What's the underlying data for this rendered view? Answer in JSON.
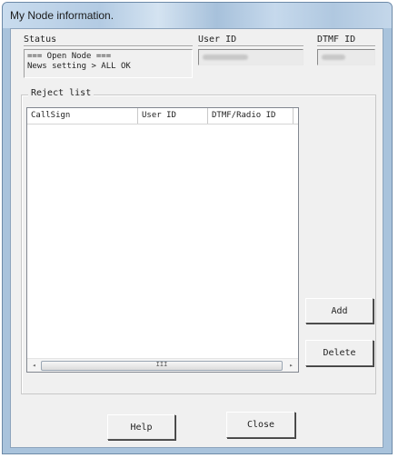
{
  "window": {
    "title": "My Node information."
  },
  "status": {
    "label": "Status",
    "line1": "=== Open Node ===",
    "line2": "News setting > ALL OK"
  },
  "user_id": {
    "label": "User ID"
  },
  "dtmf_id": {
    "label": "DTMF ID"
  },
  "reject_list": {
    "label": "Reject list",
    "columns": [
      "CallSign",
      "User ID",
      "DTMF/Radio ID"
    ],
    "rows": []
  },
  "scrollbar": {
    "left_arrow": "◂",
    "right_arrow": "▸",
    "grip": "III"
  },
  "buttons": {
    "add": "Add",
    "delete": "Delete",
    "help": "Help",
    "close": "Close"
  }
}
